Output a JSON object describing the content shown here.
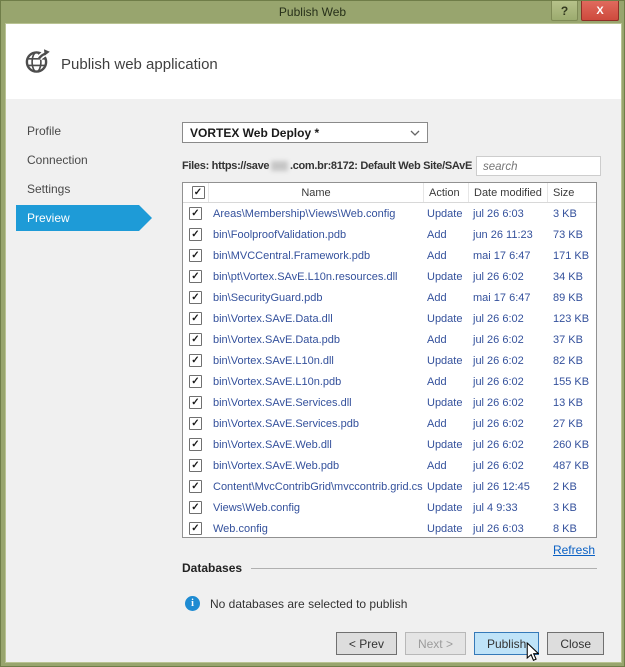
{
  "titlebar": {
    "title": "Publish Web",
    "help_glyph": "?",
    "close_glyph": "x"
  },
  "header": {
    "title": "Publish web application"
  },
  "sidebar": {
    "items": [
      {
        "id": "profile",
        "label": "Profile",
        "selected": false
      },
      {
        "id": "connection",
        "label": "Connection",
        "selected": false
      },
      {
        "id": "settings",
        "label": "Settings",
        "selected": false
      },
      {
        "id": "preview",
        "label": "Preview",
        "selected": true
      }
    ]
  },
  "main": {
    "profile_dropdown": {
      "value": "VORTEX Web Deploy *"
    },
    "files_line": {
      "prefix": "Files: https://save",
      "redacted": true,
      "suffix": ".com.br:8172: Default Web Site/SAvE"
    },
    "search": {
      "placeholder": "search"
    },
    "table": {
      "headers": {
        "name": "Name",
        "action": "Action",
        "date_modified": "Date modified",
        "size": "Size"
      },
      "header_checkbox_checked": true,
      "rows": [
        {
          "checked": true,
          "name": "Areas\\Membership\\Views\\Web.config",
          "action": "Update",
          "date": "jul 26 6:03",
          "size": "3 KB"
        },
        {
          "checked": true,
          "name": "bin\\FoolproofValidation.pdb",
          "action": "Add",
          "date": "jun 26 11:23",
          "size": "73 KB"
        },
        {
          "checked": true,
          "name": "bin\\MVCCentral.Framework.pdb",
          "action": "Add",
          "date": "mai 17 6:47",
          "size": "171 KB"
        },
        {
          "checked": true,
          "name": "bin\\pt\\Vortex.SAvE.L10n.resources.dll",
          "action": "Update",
          "date": "jul 26 6:02",
          "size": "34 KB"
        },
        {
          "checked": true,
          "name": "bin\\SecurityGuard.pdb",
          "action": "Add",
          "date": "mai 17 6:47",
          "size": "89 KB"
        },
        {
          "checked": true,
          "name": "bin\\Vortex.SAvE.Data.dll",
          "action": "Update",
          "date": "jul 26 6:02",
          "size": "123 KB"
        },
        {
          "checked": true,
          "name": "bin\\Vortex.SAvE.Data.pdb",
          "action": "Add",
          "date": "jul 26 6:02",
          "size": "37 KB"
        },
        {
          "checked": true,
          "name": "bin\\Vortex.SAvE.L10n.dll",
          "action": "Update",
          "date": "jul 26 6:02",
          "size": "82 KB"
        },
        {
          "checked": true,
          "name": "bin\\Vortex.SAvE.L10n.pdb",
          "action": "Add",
          "date": "jul 26 6:02",
          "size": "155 KB"
        },
        {
          "checked": true,
          "name": "bin\\Vortex.SAvE.Services.dll",
          "action": "Update",
          "date": "jul 26 6:02",
          "size": "13 KB"
        },
        {
          "checked": true,
          "name": "bin\\Vortex.SAvE.Services.pdb",
          "action": "Add",
          "date": "jul 26 6:02",
          "size": "27 KB"
        },
        {
          "checked": true,
          "name": "bin\\Vortex.SAvE.Web.dll",
          "action": "Update",
          "date": "jul 26 6:02",
          "size": "260 KB"
        },
        {
          "checked": true,
          "name": "bin\\Vortex.SAvE.Web.pdb",
          "action": "Add",
          "date": "jul 26 6:02",
          "size": "487 KB"
        },
        {
          "checked": true,
          "name": "Content\\MvcContribGrid\\mvccontrib.grid.css",
          "action": "Update",
          "date": "jul 26 12:45",
          "size": "2 KB"
        },
        {
          "checked": true,
          "name": "Views\\Web.config",
          "action": "Update",
          "date": "jul 4 9:33",
          "size": "3 KB"
        },
        {
          "checked": true,
          "name": "Web.config",
          "action": "Update",
          "date": "jul 26 6:03",
          "size": "8 KB"
        }
      ]
    },
    "refresh_label": "Refresh"
  },
  "databases": {
    "heading": "Databases",
    "info_message": "No databases are selected to publish"
  },
  "footer_buttons": [
    {
      "id": "prev",
      "label": "< Prev",
      "enabled": true,
      "focused": false
    },
    {
      "id": "next",
      "label": "Next >",
      "enabled": false,
      "focused": false
    },
    {
      "id": "publish",
      "label": "Publish",
      "enabled": true,
      "focused": true
    },
    {
      "id": "close",
      "label": "Close",
      "enabled": true,
      "focused": false
    }
  ],
  "glyphs": {
    "check": "✓",
    "info": "i"
  },
  "colors": {
    "accent_blue": "#1e9bd7",
    "row_text_blue": "#34519c",
    "titlebar_olive": "#98a56e",
    "close_red": "#ce4a3d",
    "link_blue": "#0b61c4",
    "info_blue": "#1e8bd2",
    "publish_bg": "#bfe3f8",
    "publish_border": "#3579b8"
  }
}
